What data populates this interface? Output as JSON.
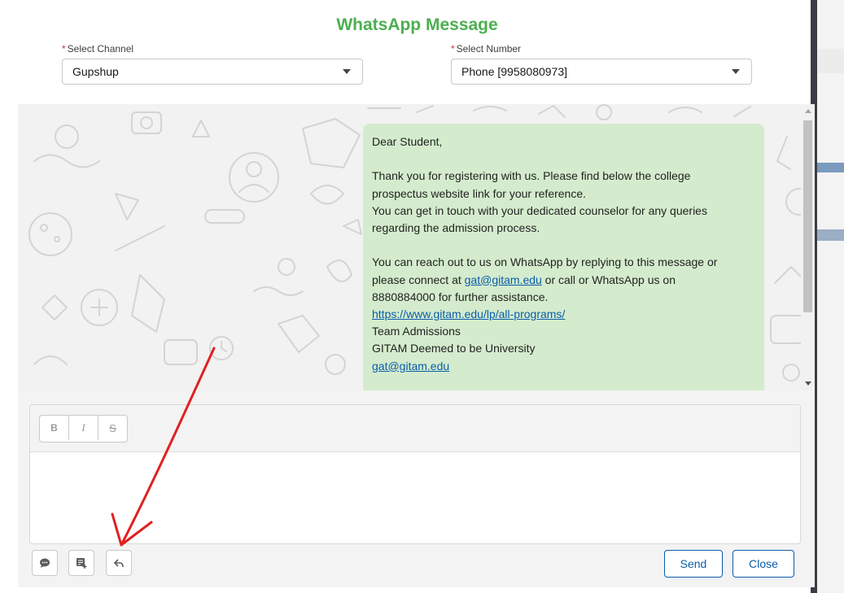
{
  "modal": {
    "title": "WhatsApp Message"
  },
  "channel": {
    "label": "Select Channel",
    "required_mark": "*",
    "value": "Gupshup"
  },
  "number": {
    "label": "Select Number",
    "required_mark": "*",
    "value": "Phone [9958080973]"
  },
  "message": {
    "greeting": "Dear Student,",
    "para1_line1": "Thank you for registering with us. Please find below the college",
    "para1_line2": "prospectus website link for your reference.",
    "para1_line3": "You can get in touch with your dedicated counselor for any queries",
    "para1_line4": "regarding the admission process.",
    "para2_line1": "You can reach out to us on WhatsApp by replying to this message or",
    "para2_pre_email": "please connect at ",
    "email": "gat@gitam.edu",
    "para2_post_email": " or call or WhatsApp us on",
    "para2_line3": "8880884000 for further assistance.",
    "link": "https://www.gitam.edu/lp/all-programs/",
    "sign1": "Team Admissions",
    "sign2": "GITAM Deemed to be University",
    "sign_email": "gat@gitam.edu"
  },
  "editor": {
    "bold_label": "B",
    "italic_label": "I",
    "strike_label": "S"
  },
  "footer": {
    "send_label": "Send",
    "close_label": "Close"
  },
  "icons": {
    "chat": "chat-bubble-icon",
    "template": "insert-template-icon",
    "reply": "reply-icon"
  },
  "colors": {
    "title": "#4caf50",
    "bubble": "#d4eccd",
    "link": "#0b5cab",
    "required": "#c23934",
    "annotation_arrow": "#e02020"
  }
}
